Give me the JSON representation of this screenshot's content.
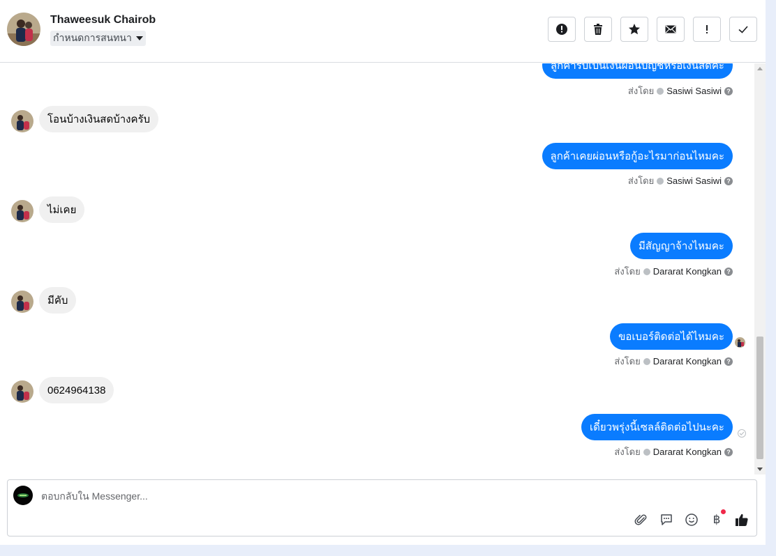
{
  "header": {
    "contact_name": "Thaweesuk Chairob",
    "label_button": "กำหนดการสนทนา",
    "actions": [
      {
        "name": "report-spam-button",
        "icon": "alert-circle-icon"
      },
      {
        "name": "delete-button",
        "icon": "trash-icon"
      },
      {
        "name": "star-button",
        "icon": "star-icon"
      },
      {
        "name": "mark-unread-button",
        "icon": "envelope-icon"
      },
      {
        "name": "follow-up-button",
        "icon": "exclamation-icon"
      },
      {
        "name": "mark-done-button",
        "icon": "check-icon"
      }
    ]
  },
  "messages": [
    {
      "dir": "out",
      "text": "ลูกค้ารับเป็นเงินผ่อนบัญชีหรือเงินสดคะ",
      "sent_by_label": "ส่งโดย",
      "agent": "Sasiwi Sasiwi"
    },
    {
      "dir": "in",
      "text": "โอนบ้างเงินสดบ้างครับ"
    },
    {
      "dir": "out",
      "text": "ลูกค้าเคยผ่อนหรือกู้อะไรมาก่อนไหมคะ",
      "sent_by_label": "ส่งโดย",
      "agent": "Sasiwi Sasiwi"
    },
    {
      "dir": "in",
      "text": "ไม่เคย"
    },
    {
      "dir": "out",
      "text": "มีสัญญาจ้างไหมคะ",
      "sent_by_label": "ส่งโดย",
      "agent": "Dararat Kongkan"
    },
    {
      "dir": "in",
      "text": "มีคับ"
    },
    {
      "dir": "out",
      "text": "ขอเบอร์ติดต่อได้ไหมคะ",
      "sent_by_label": "ส่งโดย",
      "agent": "Dararat Kongkan"
    },
    {
      "dir": "in",
      "text": "0624964138"
    },
    {
      "dir": "out",
      "text": "เดี๋ยวพรุ่งนี้เซลล์ติดต่อไปนะคะ",
      "sent_by_label": "ส่งโดย",
      "agent": "Dararat Kongkan"
    }
  ],
  "composer": {
    "placeholder": "ตอบกลับใน Messenger...",
    "tools": [
      "paperclip-icon",
      "saved-reply-icon",
      "emoji-icon",
      "baht-payment-icon",
      "thumbs-up-icon"
    ]
  },
  "colors": {
    "outgoing_bubble": "#0a7cff",
    "incoming_bubble": "#f0f0f0",
    "notification_dot": "#f02849"
  }
}
